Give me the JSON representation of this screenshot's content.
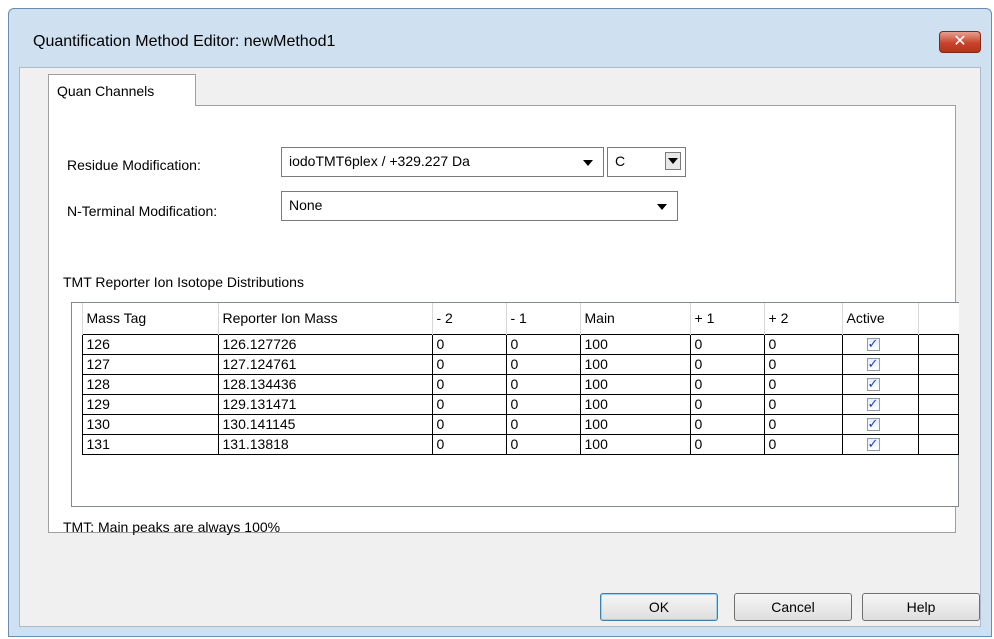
{
  "window": {
    "title": "Quantification Method Editor: newMethod1"
  },
  "tab": {
    "label": "Quan Channels"
  },
  "residue": {
    "label": "Residue Modification:",
    "value": "iodoTMT6plex / +329.227 Da",
    "residue_value": "C"
  },
  "nterm": {
    "label": "N-Terminal Modification:",
    "value": "None"
  },
  "table": {
    "section_label": "TMT Reporter Ion Isotope Distributions",
    "columns": [
      "Mass Tag",
      "Reporter Ion Mass",
      "- 2",
      "- 1",
      "Main",
      "+ 1",
      "+ 2",
      "Active"
    ],
    "rows": [
      [
        "126",
        "126.127726",
        "0",
        "0",
        "100",
        "0",
        "0",
        true
      ],
      [
        "127",
        "127.124761",
        "0",
        "0",
        "100",
        "0",
        "0",
        true
      ],
      [
        "128",
        "128.134436",
        "0",
        "0",
        "100",
        "0",
        "0",
        true
      ],
      [
        "129",
        "129.131471",
        "0",
        "0",
        "100",
        "0",
        "0",
        true
      ],
      [
        "130",
        "130.141145",
        "0",
        "0",
        "100",
        "0",
        "0",
        true
      ],
      [
        "131",
        "131.13818",
        "0",
        "0",
        "100",
        "0",
        "0",
        true
      ]
    ],
    "note": "TMT: Main peaks are always 100%"
  },
  "buttons": {
    "ok": "OK",
    "cancel": "Cancel",
    "help": "Help"
  },
  "colors": {
    "frame": "#cfe0f1",
    "close": "#c8442c",
    "check": "#1d3fb8"
  },
  "icons": {
    "close": "close-icon",
    "dropdown": "chevron-down-icon"
  }
}
